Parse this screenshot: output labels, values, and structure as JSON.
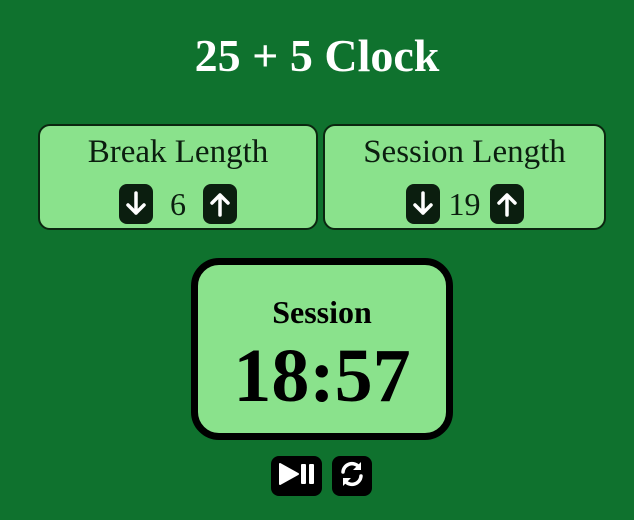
{
  "app": {
    "title": "25 + 5 Clock"
  },
  "break": {
    "label": "Break Length",
    "value": "6",
    "decrement_icon": "arrow-down-icon",
    "increment_icon": "arrow-up-icon"
  },
  "session": {
    "label": "Session Length",
    "value": "19",
    "decrement_icon": "arrow-down-icon",
    "increment_icon": "arrow-up-icon"
  },
  "timer": {
    "label": "Session",
    "time": "18:57"
  },
  "controls": {
    "play_pause_icon": "play-pause-icon",
    "reset_icon": "refresh-icon"
  },
  "colors": {
    "background": "#0f722e",
    "panel": "#8ae28c",
    "button": "#0b1e0f",
    "title_text": "#ffffff"
  }
}
